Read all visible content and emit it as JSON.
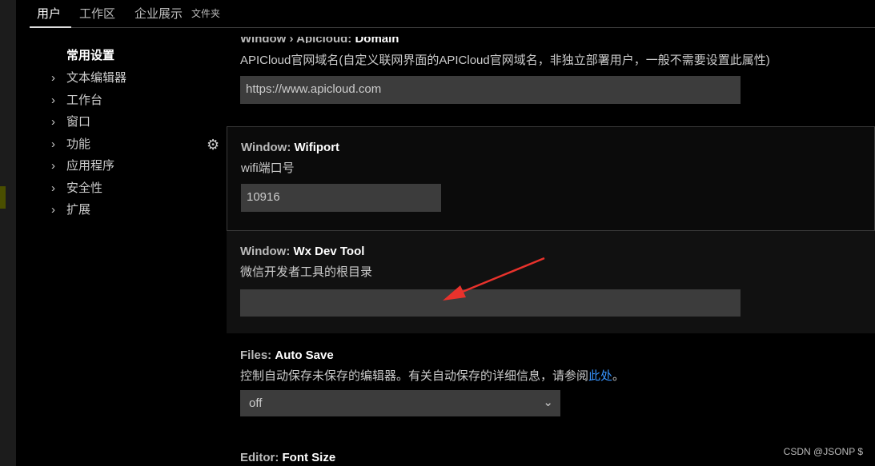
{
  "tabs": [
    {
      "label": "用户"
    },
    {
      "label": "工作区"
    },
    {
      "label": "企业展示"
    },
    {
      "label": "文件夹"
    }
  ],
  "nav": {
    "head": "常用设置",
    "items": [
      {
        "label": "文本编辑器"
      },
      {
        "label": "工作台"
      },
      {
        "label": "窗口"
      },
      {
        "label": "功能"
      },
      {
        "label": "应用程序"
      },
      {
        "label": "安全性"
      },
      {
        "label": "扩展"
      }
    ]
  },
  "settings": {
    "domain": {
      "category": "Window › Apicloud: ",
      "name": "Domain",
      "desc": "APICloud官网域名(自定义联网界面的APICloud官网域名，非独立部署用户，一般不需要设置此属性)",
      "value": "https://www.apicloud.com"
    },
    "wifiport": {
      "category": "Window: ",
      "name": "Wifiport",
      "desc": "wifi端口号",
      "value": "10916"
    },
    "wxdevtool": {
      "category": "Window: ",
      "name": "Wx Dev Tool",
      "desc": "微信开发者工具的根目录",
      "value": ""
    },
    "autosave": {
      "category": "Files: ",
      "name": "Auto Save",
      "desc": "控制自动保存未保存的编辑器。有关自动保存的详细信息，请参阅",
      "link": "此处",
      "desc_end": "。",
      "value": "off"
    },
    "fontsize": {
      "category": "Editor: ",
      "name": "Font Size"
    }
  },
  "annotation_color": "#e8322c",
  "link_color": "#3794ff",
  "watermark": "CSDN @JSONP $"
}
